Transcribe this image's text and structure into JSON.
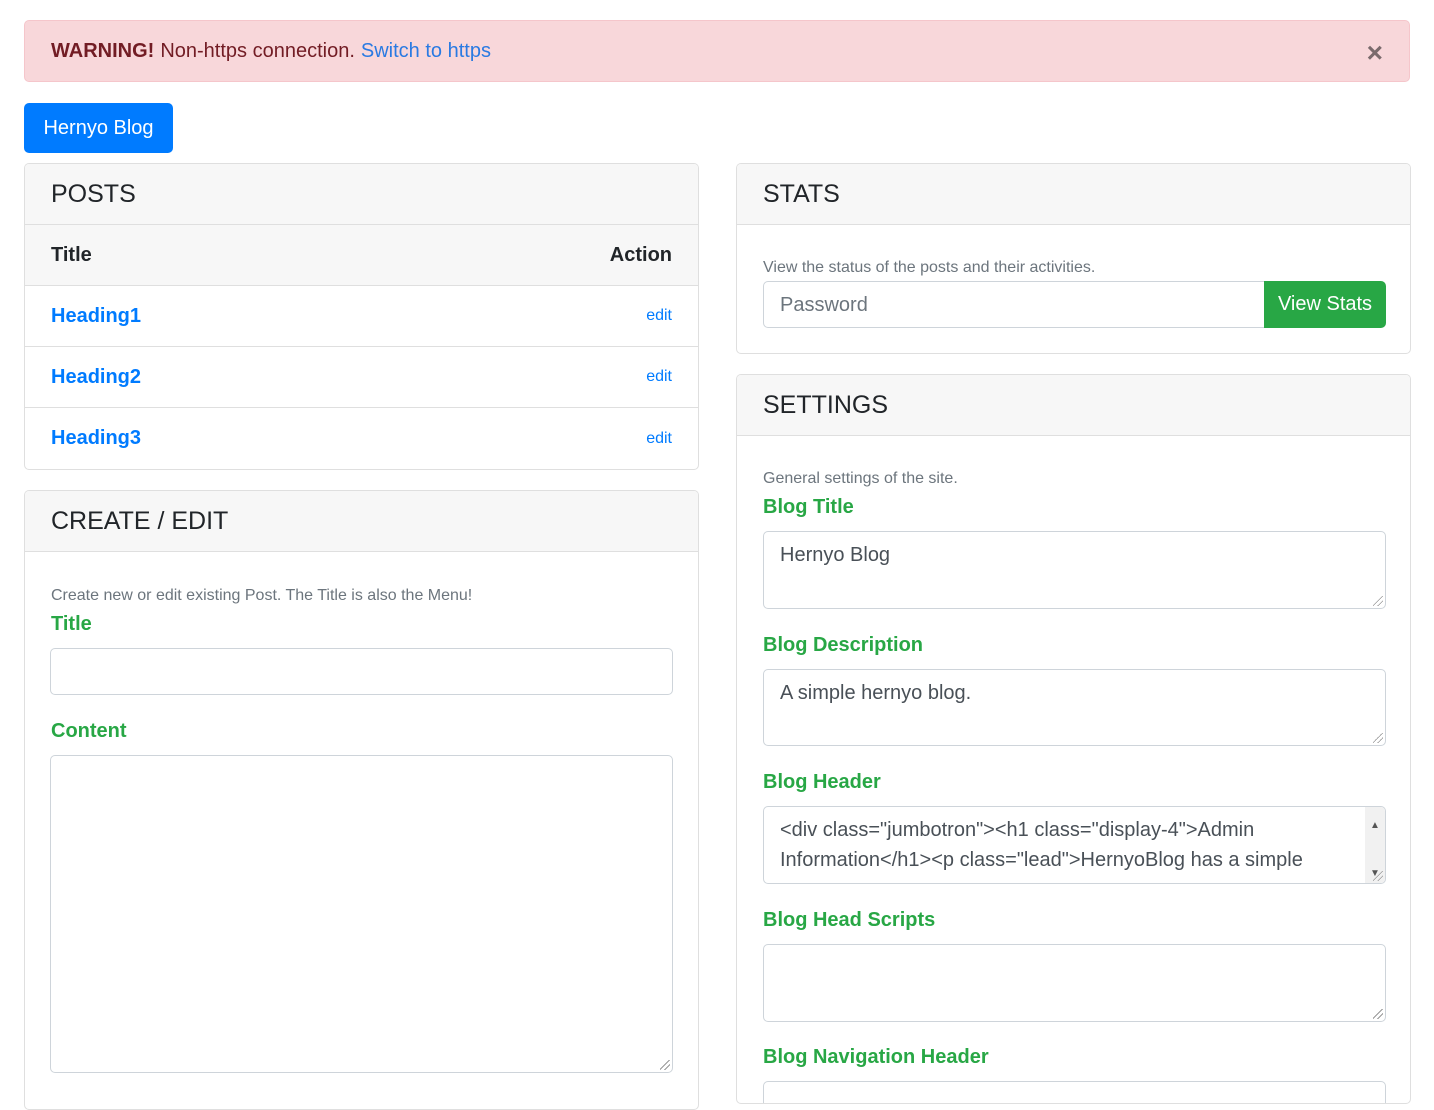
{
  "alert": {
    "strong": "WARNING!",
    "text": "Non-https connection.",
    "link": "Switch to https",
    "close": "×"
  },
  "brand": "Hernyo Blog",
  "posts": {
    "title": "POSTS",
    "col_title": "Title",
    "col_action": "Action",
    "rows": [
      {
        "title": "Heading1",
        "action": "edit"
      },
      {
        "title": "Heading2",
        "action": "edit"
      },
      {
        "title": "Heading3",
        "action": "edit"
      }
    ]
  },
  "create": {
    "title": "CREATE / EDIT",
    "description": "Create new or edit existing Post. The Title is also the Menu!",
    "title_label": "Title",
    "title_value": "",
    "content_label": "Content",
    "content_value": ""
  },
  "stats": {
    "title": "STATS",
    "description": "View the status of the posts and their activities.",
    "password_placeholder": "Password",
    "button": "View Stats"
  },
  "settings": {
    "title": "SETTINGS",
    "description": "General settings of the site.",
    "fields": [
      {
        "label": "Blog Title",
        "value": "Hernyo Blog"
      },
      {
        "label": "Blog Description",
        "value": "A simple hernyo blog."
      },
      {
        "label": "Blog Header",
        "value": "<div class=\"jumbotron\"><h1 class=\"display-4\">Admin Information</h1><p class=\"lead\">HernyoBlog has a simple"
      },
      {
        "label": "Blog Head Scripts",
        "value": ""
      },
      {
        "label": "Blog Navigation Header",
        "value": ""
      }
    ]
  }
}
